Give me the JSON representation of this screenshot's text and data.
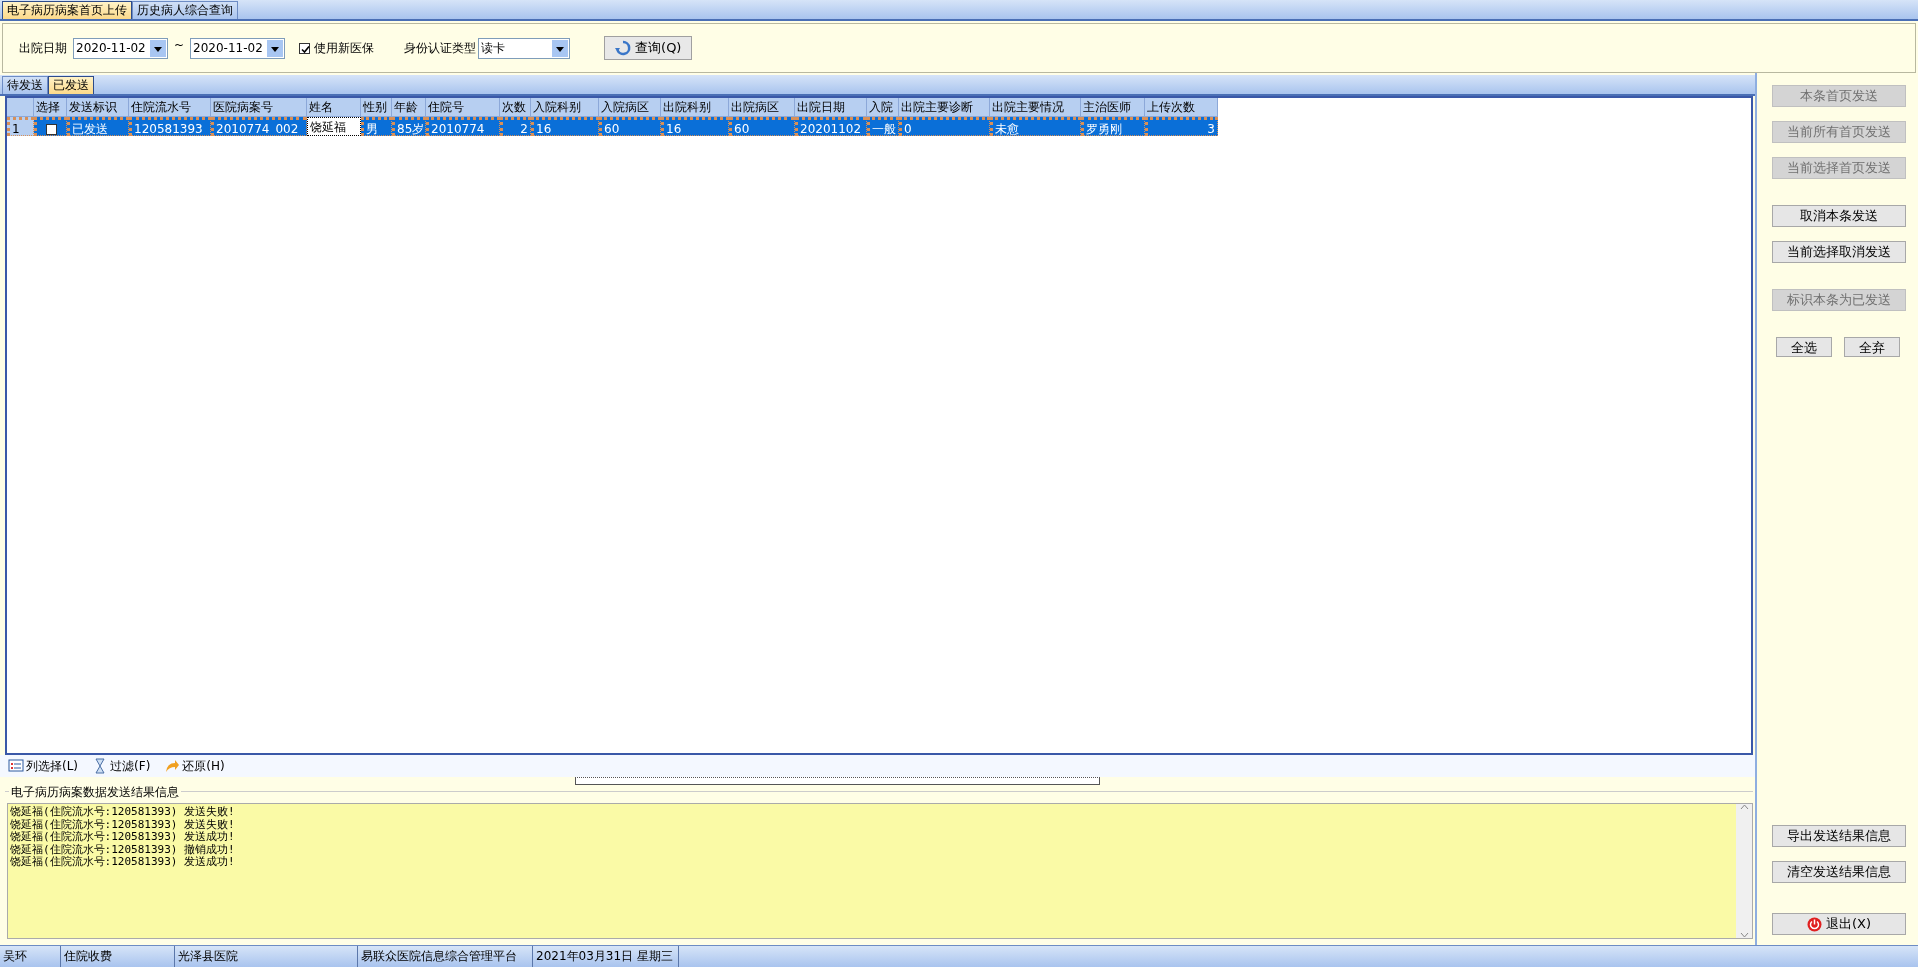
{
  "main_tabs": [
    {
      "label": "电子病历病案首页上传",
      "selected": true
    },
    {
      "label": "历史病人综合查询",
      "selected": false
    }
  ],
  "filter": {
    "date_label": "出院日期",
    "date_from": "2020-11-02",
    "separator": "~",
    "date_to": "2020-11-02",
    "use_new_insurance": {
      "label": "使用新医保",
      "checked": true
    },
    "id_type_label": "身份认证类型",
    "id_type_value": "读卡",
    "query_button": "查询(Q)"
  },
  "sub_tabs": [
    {
      "label": "待发送",
      "selected": false
    },
    {
      "label": "已发送",
      "selected": true
    }
  ],
  "table": {
    "columns": [
      {
        "label": "选择"
      },
      {
        "label": "发送标识",
        "right_aligned": false
      },
      {
        "label": "住院流水号",
        "right_aligned": false
      },
      {
        "label": "医院病案号",
        "right_aligned": false
      },
      {
        "label": "姓名",
        "right_aligned": false
      },
      {
        "label": "性别",
        "right_aligned": false
      },
      {
        "label": "年龄"
      },
      {
        "label": "住院号",
        "right_aligned": false
      },
      {
        "label": "次数",
        "right_aligned": true
      },
      {
        "label": "入院科别",
        "right_aligned": false
      },
      {
        "label": "入院病区",
        "right_aligned": false
      },
      {
        "label": "出院科别",
        "right_aligned": false
      },
      {
        "label": "出院病区",
        "right_aligned": false
      },
      {
        "label": "出院日期",
        "right_aligned": false
      },
      {
        "label": "入院"
      },
      {
        "label": "出院主要诊断",
        "right_aligned": false
      },
      {
        "label": "出院主要情况",
        "right_aligned": false
      },
      {
        "label": "主治医师",
        "right_aligned": false
      },
      {
        "label": "上传次数",
        "right_aligned": true
      }
    ],
    "rows": [
      {
        "row_number": "1",
        "selected": true,
        "cells": [
          {
            "kind": "checkbox",
            "checked": false,
            "focused": false
          },
          {
            "text": "已发送",
            "focused": false
          },
          {
            "text": "120581393",
            "focused": false
          },
          {
            "text": "2010774_002",
            "focused": false
          },
          {
            "text": "饶延福",
            "focused": true
          },
          {
            "text": "男",
            "focused": false
          },
          {
            "text": "85岁",
            "focused": false
          },
          {
            "text": "2010774",
            "focused": false
          },
          {
            "text": "2",
            "focused": false
          },
          {
            "text": "16",
            "focused": false
          },
          {
            "text": "60",
            "focused": false
          },
          {
            "text": "16",
            "focused": false
          },
          {
            "text": "60",
            "focused": false
          },
          {
            "text": "20201102",
            "focused": false
          },
          {
            "text": "一般",
            "focused": false
          },
          {
            "text": "0",
            "focused": false
          },
          {
            "text": "未愈",
            "focused": false
          },
          {
            "text": "罗勇刚",
            "focused": false
          },
          {
            "text": "3",
            "focused": false
          }
        ]
      }
    ]
  },
  "toolbar": [
    {
      "label": "列选择(L)",
      "kind": "columns"
    },
    {
      "label": "过滤(F)",
      "kind": "filter"
    },
    {
      "label": "还原(H)",
      "kind": "restore"
    }
  ],
  "log": {
    "title": "电子病历病案数据发送结果信息",
    "lines": [
      "饶延福(住院流水号:120581393) 发送失败!",
      "饶延福(住院流水号:120581393) 发送失败!",
      "饶延福(住院流水号:120581393) 发送成功!",
      "饶延福(住院流水号:120581393) 撤销成功!",
      "饶延福(住院流水号:120581393) 发送成功!"
    ]
  },
  "side_panel": {
    "groups": [
      {
        "kind": "stack",
        "buttons": [
          {
            "label": "本条首页发送",
            "disabled": true
          },
          {
            "label": "当前所有首页发送",
            "disabled": true
          },
          {
            "label": "当前选择首页发送",
            "disabled": true
          }
        ]
      },
      {
        "kind": "stack",
        "buttons": [
          {
            "label": "取消本条发送",
            "disabled": false
          },
          {
            "label": "当前选择取消发送",
            "disabled": false
          }
        ]
      },
      {
        "kind": "stack",
        "buttons": [
          {
            "label": "标识本条为已发送",
            "disabled": true
          }
        ]
      },
      {
        "kind": "row",
        "buttons": [
          {
            "label": "全选",
            "disabled": false
          },
          {
            "label": "全弃",
            "disabled": false
          }
        ]
      }
    ],
    "bottom_buttons": [
      {
        "label": "导出发送结果信息",
        "kind": "plain",
        "disabled": false
      },
      {
        "label": "清空发送结果信息",
        "kind": "plain",
        "disabled": false
      },
      {
        "label": "退出(X)",
        "kind": "exit",
        "disabled": false
      }
    ]
  },
  "status_bar": [
    "吴环",
    "住院收费",
    "光泽县医院",
    "易联众医院信息综合管理平台",
    "2021年03月31日 星期三"
  ]
}
